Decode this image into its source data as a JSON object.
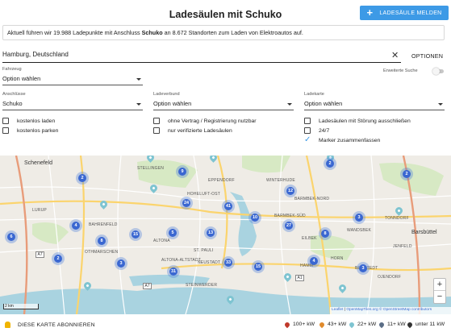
{
  "header": {
    "title": "Ladesäulen mit Schuko",
    "add_button_label": "LADESÄULE MELDEN"
  },
  "info": {
    "prefix": "Aktuell führen wir 19.988 Ladepunkte mit Anschluss",
    "highlight": "Schuko",
    "suffix": "an 8.672 Standorten zum Laden von Elektroautos auf."
  },
  "search": {
    "value": "Hamburg, Deutschland",
    "options_label": "OPTIONEN"
  },
  "filters": {
    "fahrzeug": {
      "label": "Fahrzeug",
      "value": "Option wählen"
    },
    "erweiterte_suche": {
      "label": "Erweiterte Suche",
      "enabled": false
    },
    "anschluesse": {
      "label": "Anschlüsse",
      "value": "Schuko"
    },
    "ladeverbund": {
      "label": "Ladeverbund",
      "value": "Option wählen"
    },
    "ladekarte": {
      "label": "Ladekarte",
      "value": "Option wählen"
    }
  },
  "checkboxes": {
    "col1": [
      {
        "label": "kostenlos laden",
        "checked": false
      },
      {
        "label": "kostenlos parken",
        "checked": false
      }
    ],
    "col2": [
      {
        "label": "ohne Vertrag / Registrierung nutzbar",
        "checked": false
      },
      {
        "label": "nur verifizierte Ladesäulen",
        "checked": false
      }
    ],
    "col3": [
      {
        "label": "Ladesäulen mit Störung ausschließen",
        "checked": false
      },
      {
        "label": "24/7",
        "checked": false
      },
      {
        "label": "Marker zusammenfassen",
        "checked": true
      }
    ]
  },
  "map": {
    "places": [
      "Schenefeld",
      "STELLINGEN",
      "WINTERHUDE",
      "BARMBEK-NORD",
      "EPPENDORF",
      "HOHELUFT-OST",
      "BARMBEK-SÜD",
      "LURUP",
      "BAHRENFELD",
      "OTHMARSCHEN",
      "ALTONA-ALTSTADT",
      "NEUSTADT",
      "HAMM",
      "HORN",
      "STEINWERDER",
      "EILBEK",
      "WANDSBEK",
      "JENFELD",
      "TONNDORF",
      "OJENDORF",
      "Barsbüttel",
      "BILLSTEDT",
      "ALTONA",
      "ST. PAULI"
    ],
    "clusters": [
      "2",
      "9",
      "2",
      "12",
      "24",
      "41",
      "10",
      "27",
      "3",
      "2",
      "4",
      "8",
      "5",
      "15",
      "13",
      "6",
      "2",
      "3",
      "33",
      "15",
      "31",
      "4",
      "3",
      "8"
    ],
    "road_numbers": [
      "A7",
      "A7",
      "A1"
    ],
    "scale_label": "2 km",
    "zoom_in": "+",
    "zoom_out": "−",
    "attribution": {
      "leaflet": "Leaflet",
      "tiles": "OpenMapTiles.org",
      "copyright": "© OpenStreetMap contributors"
    },
    "colors": {
      "cluster": "#3a67d1",
      "pin": "#7ec4d1",
      "road_major": "#fbd46d",
      "water": "#a9d3e0",
      "park": "#d7e9c4"
    }
  },
  "footer": {
    "subscribe_label": "DIESE KARTE ABONNIEREN",
    "legend": [
      {
        "label": "100+ kW",
        "color": "#c0392b"
      },
      {
        "label": "43+ kW",
        "color": "#e08a2c"
      },
      {
        "label": "22+ kW",
        "color": "#7ec4d1"
      },
      {
        "label": "11+ kW",
        "color": "#5a6d86"
      },
      {
        "label": "unter 11 kW",
        "color": "#333333"
      }
    ]
  }
}
